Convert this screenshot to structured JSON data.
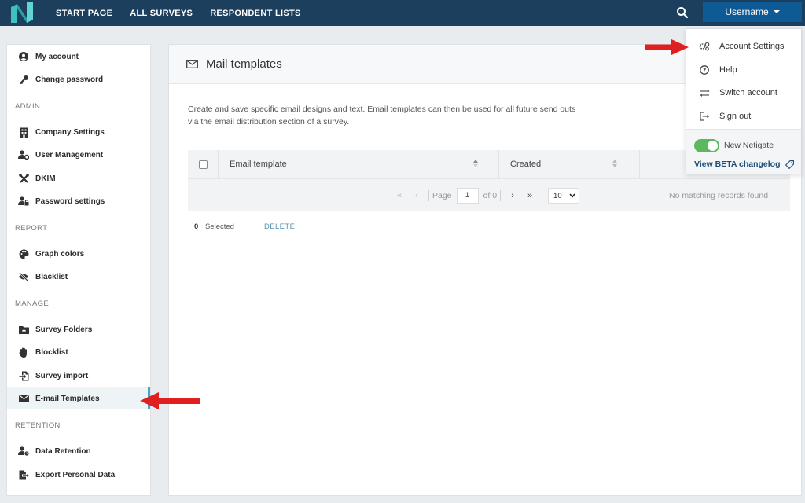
{
  "topbar": {
    "nav": [
      "START PAGE",
      "ALL SURVEYS",
      "RESPONDENT LISTS"
    ],
    "username": "Username",
    "brand_color": "#1c3f5e",
    "logo_color": "#3cc3c0"
  },
  "sidebar": {
    "top_items": [
      {
        "label": "My account",
        "icon": "user-circle-icon"
      },
      {
        "label": "Change password",
        "icon": "key-icon"
      }
    ],
    "sections": [
      {
        "title": "ADMIN",
        "items": [
          {
            "label": "Company Settings",
            "icon": "building-icon"
          },
          {
            "label": "User Management",
            "icon": "user-gear-icon"
          },
          {
            "label": "DKIM",
            "icon": "tools-icon"
          },
          {
            "label": "Password settings",
            "icon": "user-lock-icon"
          }
        ]
      },
      {
        "title": "REPORT",
        "items": [
          {
            "label": "Graph colors",
            "icon": "palette-icon"
          },
          {
            "label": "Blacklist",
            "icon": "eye-slash-icon"
          }
        ]
      },
      {
        "title": "MANAGE",
        "items": [
          {
            "label": "Survey Folders",
            "icon": "folder-plus-icon"
          },
          {
            "label": "Blocklist",
            "icon": "hand-icon"
          },
          {
            "label": "Survey import",
            "icon": "file-import-icon"
          },
          {
            "label": "E-mail Templates",
            "icon": "envelope-icon",
            "active": true
          }
        ]
      },
      {
        "title": "RETENTION",
        "items": [
          {
            "label": "Data Retention",
            "icon": "user-clock-icon"
          },
          {
            "label": "Export Personal Data",
            "icon": "file-export-icon"
          }
        ]
      }
    ]
  },
  "main": {
    "title": "Mail templates",
    "description": "Create and save specific email designs and text. Email templates can then be used for all future send outs via the email distribution section of a survey.",
    "columns": [
      "Email template",
      "Created"
    ],
    "pager": {
      "page_label": "Page",
      "page": "1",
      "of_label": "of 0",
      "page_size": "10"
    },
    "no_records": "No matching records found",
    "selected_count": "0",
    "selected_label": "Selected",
    "delete_label": "DELETE"
  },
  "dropdown": {
    "items": [
      {
        "label": "Account Settings",
        "icon": "cogs-icon"
      },
      {
        "label": "Help",
        "icon": "question-circle-icon"
      },
      {
        "label": "Switch account",
        "icon": "exchange-icon"
      },
      {
        "label": "Sign out",
        "icon": "sign-out-icon"
      }
    ],
    "toggle_label": "New Netigate",
    "toggle_on": true,
    "beta_link": "View BETA changelog"
  },
  "annotation_color": "#e02020"
}
